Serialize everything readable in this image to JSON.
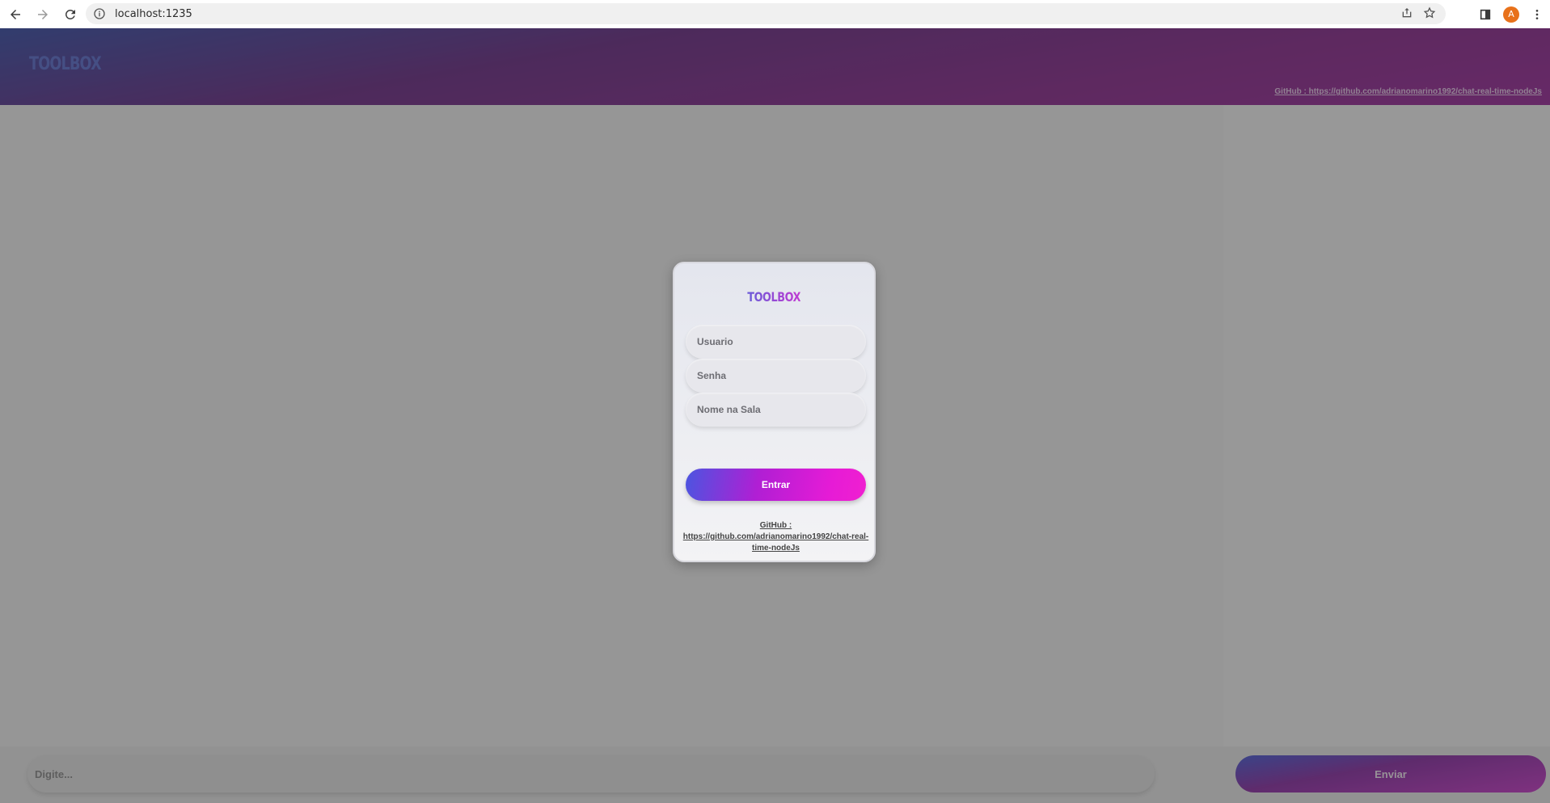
{
  "browser": {
    "url": "localhost:1235",
    "profile_initial": "A",
    "icons": {
      "back": "arrow-left-icon",
      "forward": "arrow-right-icon",
      "reload": "reload-icon",
      "site_info": "info-icon",
      "share": "share-icon",
      "bookmark": "star-icon",
      "side_panel": "side-panel-icon",
      "menu": "kebab-menu-icon"
    }
  },
  "header": {
    "logo": "TOOLBOX",
    "github_link": "GitHub : https://github.com/adrianomarino1992/chat-real-time-nodeJs"
  },
  "footer": {
    "message_placeholder": "Digite...",
    "send_label": "Enviar"
  },
  "login": {
    "logo": "TOOLBOX",
    "user_placeholder": "Usuario",
    "password_placeholder": "Senha",
    "room_name_placeholder": "Nome na Sala",
    "submit_label": "Entrar",
    "github_label": "GitHub :",
    "github_url": "https://github.com/adrianomarino1992/chat-real-time-nodeJs"
  },
  "colors": {
    "accent_start": "#4b55e0",
    "accent_end": "#f020d0",
    "header_purple": "#8a2a8e",
    "avatar_orange": "#e8711a"
  }
}
